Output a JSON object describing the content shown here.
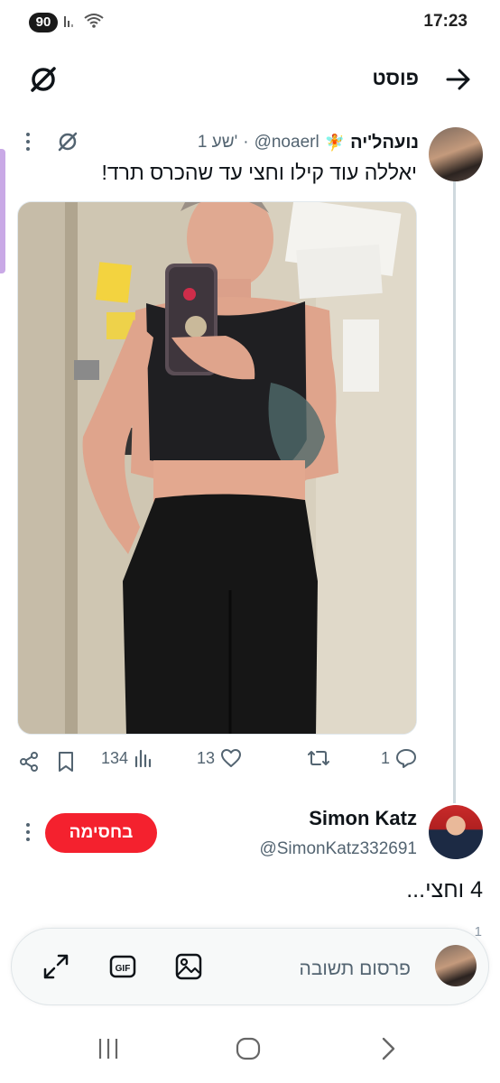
{
  "status_bar": {
    "battery": "90",
    "time": "17:23"
  },
  "header": {
    "title": "פוסט",
    "back_icon": "arrow-right-icon",
    "grok_icon": "grok-slash-icon"
  },
  "post": {
    "author_name": "נועהל'יה",
    "author_emoji": "🧚",
    "handle": "@noaerl",
    "time": "1 שע'",
    "text": "יאללה עוד קילו וחצי עד שהכרס תרד!",
    "media_alt": "mirror selfie photo",
    "stats": {
      "replies": "1",
      "reposts": "",
      "likes": "13",
      "views": "134"
    }
  },
  "reply": {
    "author_name": "Simon Katz",
    "handle": "@SimonKatz332691",
    "badge": "בחסימה",
    "text": "4 וחצי..."
  },
  "compose": {
    "placeholder": "פרסום תשובה",
    "overflow": "1"
  },
  "colors": {
    "accent": "#1d9bf0",
    "danger": "#f4212e",
    "muted": "#536471",
    "thread": "#cfd9de"
  }
}
